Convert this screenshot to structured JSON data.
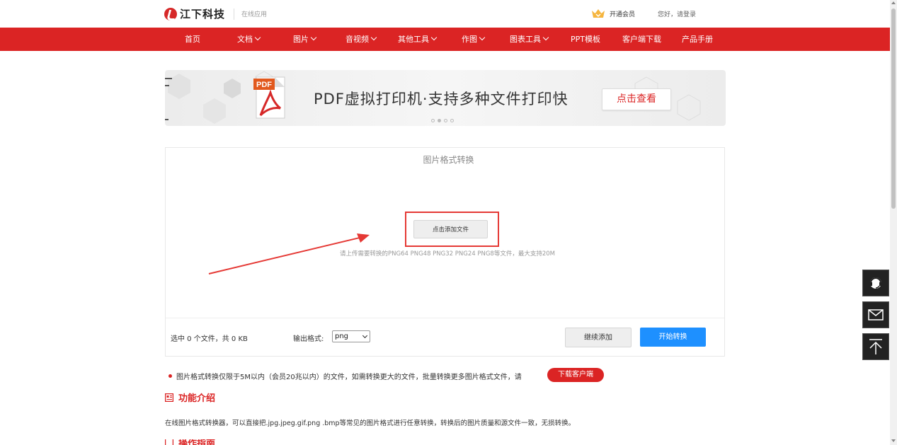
{
  "header": {
    "brand": "江下科技",
    "sub": "在线应用",
    "member": "开通会员",
    "login": "您好，请登录"
  },
  "nav": {
    "items": [
      {
        "label": "首页",
        "dropdown": false
      },
      {
        "label": "文档",
        "dropdown": true
      },
      {
        "label": "图片",
        "dropdown": true
      },
      {
        "label": "音视频",
        "dropdown": true
      },
      {
        "label": "其他工具",
        "dropdown": true
      },
      {
        "label": "作图",
        "dropdown": true
      },
      {
        "label": "图表工具",
        "dropdown": true
      },
      {
        "label": "PPT模板",
        "dropdown": false
      },
      {
        "label": "客户端下载",
        "dropdown": false
      },
      {
        "label": "产品手册",
        "dropdown": false
      }
    ]
  },
  "banner": {
    "icon_label": "PDF",
    "title": "PDF虚拟打印机·支持多种文件打印快",
    "button": "点击查看",
    "slides": 4,
    "active_slide": 2
  },
  "converter": {
    "title": "图片格式转换",
    "add_button": "点击添加文件",
    "hint": "请上传需要转换的PNG64 PNG48 PNG32 PNG24 PNG8等文件，最大支持20M",
    "selected_info": "选中 0 个文件，共 0 KB",
    "format_label": "输出格式:",
    "format_value": "png",
    "continue_button": "继续添加",
    "start_button": "开始转换"
  },
  "notice": {
    "text": "图片格式转换仅限于5M以内（会员20兆以内）的文件，如需转换更大的文件，批量转换更多图片格式文件，请",
    "button": "下载客户端"
  },
  "intro": {
    "title": "功能介绍",
    "text": "在线图片格式转换器，可以直接把.jpg.jpeg.gif.png .bmp等常见的图片格式进行任意转换，转换后的图片质量和源文件一致，无损转换。"
  },
  "guide": {
    "title": "操作指南"
  },
  "colors": {
    "brand_red": "#db2424",
    "primary_blue": "#1e90ff",
    "highlight_red": "#e53935"
  }
}
